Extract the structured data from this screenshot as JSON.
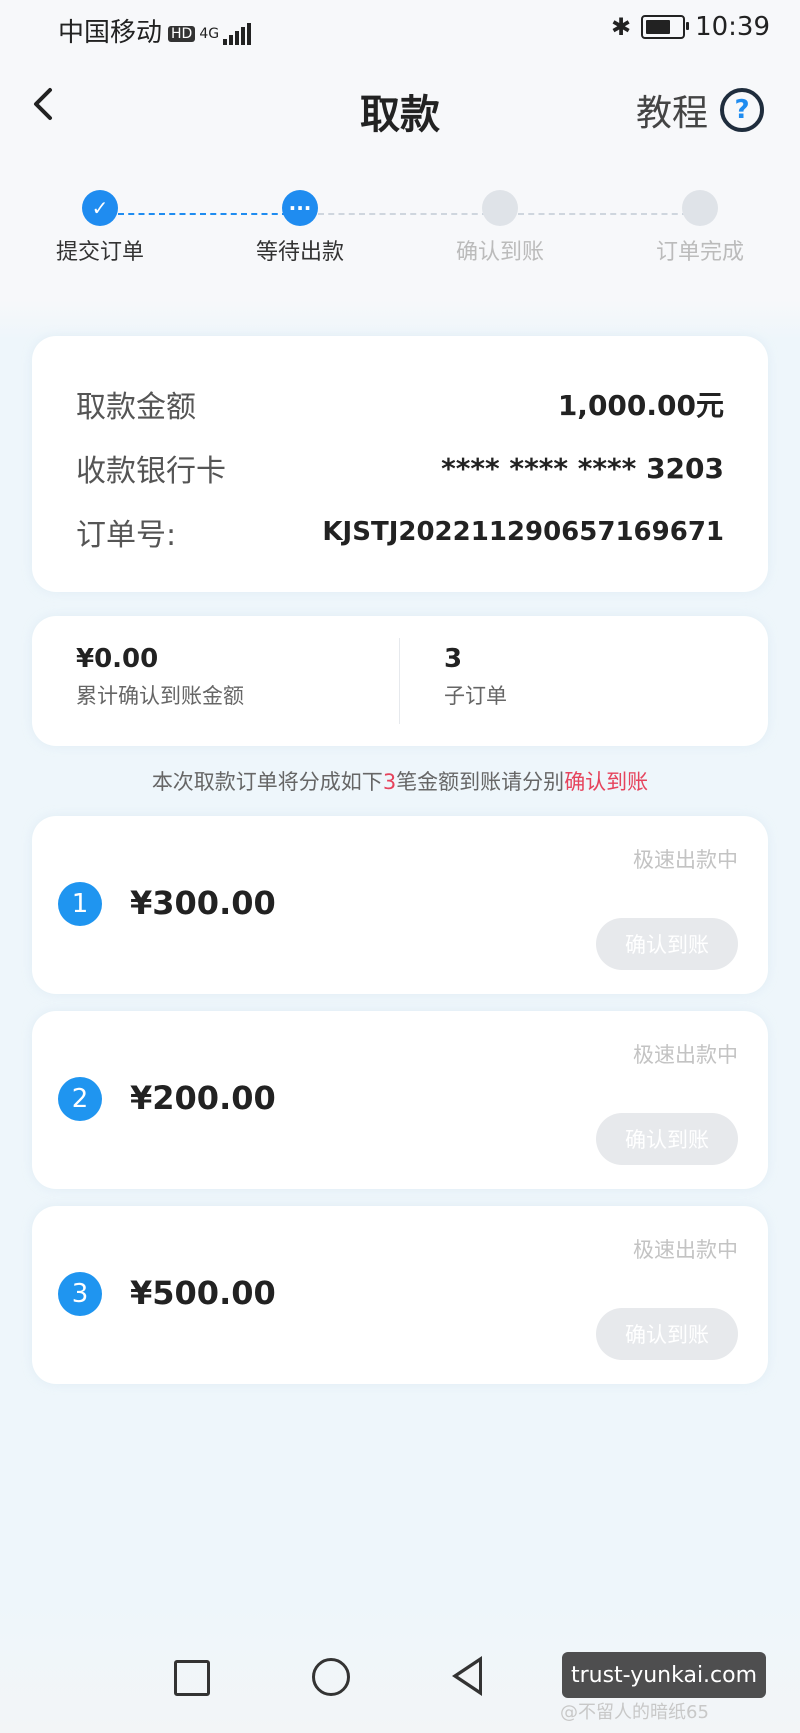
{
  "status_bar": {
    "carrier": "中国移动",
    "hd": "HD",
    "network": "4G",
    "bluetooth_icon": "bluetooth-icon",
    "time": "10:39"
  },
  "header": {
    "title": "取款",
    "tutorial_label": "教程",
    "help_icon": "?"
  },
  "steps": [
    {
      "label": "提交订单",
      "state": "done"
    },
    {
      "label": "等待出款",
      "state": "current"
    },
    {
      "label": "确认到账",
      "state": "pending"
    },
    {
      "label": "订单完成",
      "state": "pending"
    }
  ],
  "order_info": {
    "amount_label": "取款金额",
    "amount_value": "1,000.00元",
    "card_label": "收款银行卡",
    "card_value": "**** **** **** 3203",
    "order_no_label": "订单号:",
    "order_no_value": "KJSTJ20221129065716967​1"
  },
  "stats": {
    "confirmed_amount": "¥0.00",
    "confirmed_label": "累计确认到账金额",
    "sub_order_count": "3",
    "sub_order_label": "子订单"
  },
  "notice": {
    "prefix": "本次取款订单将分成如下",
    "count": "3",
    "middle": "笔金额到账请分别",
    "highlight": "确认到账"
  },
  "sub_orders": [
    {
      "index": "1",
      "amount": "¥300.00",
      "status": "极速出款中",
      "button": "确认到账"
    },
    {
      "index": "2",
      "amount": "¥200.00",
      "status": "极速出款中",
      "button": "确认到账"
    },
    {
      "index": "3",
      "amount": "¥500.00",
      "status": "极速出款中",
      "button": "确认到账"
    }
  ],
  "watermark": {
    "site": "trust-yunkai.com",
    "author": "@不留人的暗纸65"
  },
  "colors": {
    "accent": "#1f8cf0",
    "highlight_red": "#e6435c",
    "disabled_button": "#e7e9ec"
  }
}
